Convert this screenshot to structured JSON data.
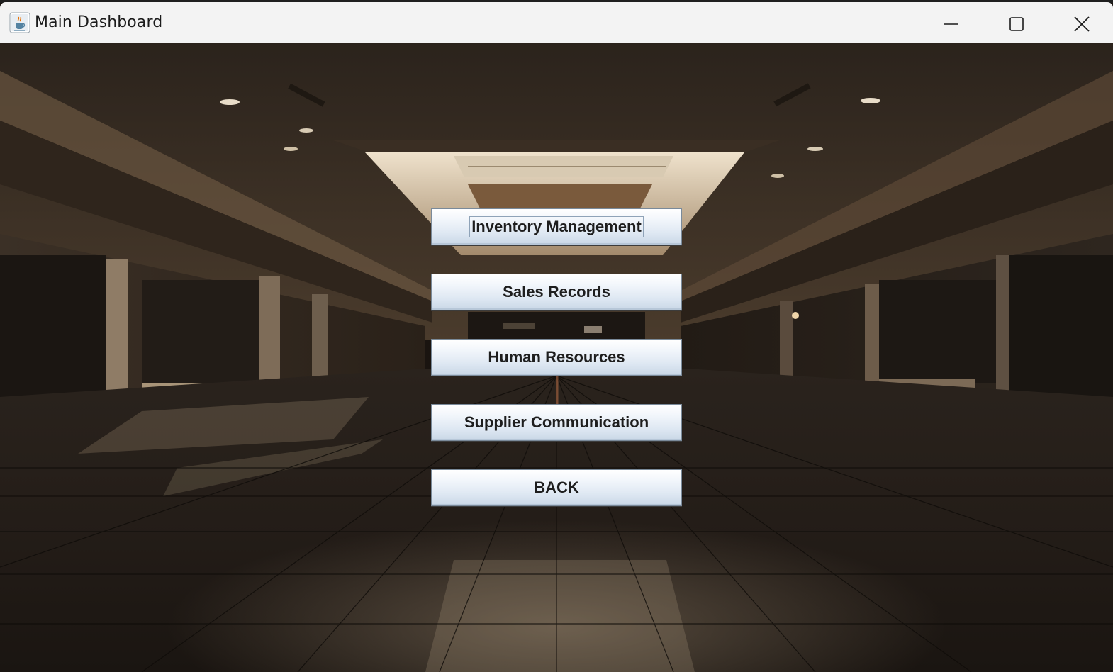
{
  "window": {
    "title": "Main Dashboard",
    "app_icon": "java-coffee-cup-icon",
    "controls": {
      "minimize": "minimize-icon",
      "maximize": "maximize-icon",
      "close": "close-icon"
    }
  },
  "menu": {
    "buttons": [
      {
        "label": "Inventory Management",
        "focused": true
      },
      {
        "label": "Sales Records"
      },
      {
        "label": "Human Resources"
      },
      {
        "label": "Supplier Communication"
      },
      {
        "label": "BACK"
      }
    ]
  },
  "background": {
    "description_icon": "empty-mall-hallway-image"
  },
  "colors": {
    "titlebar": "#f3f3f3",
    "button_top": "#ffffff",
    "button_bottom": "#c9d7e6",
    "button_border": "#7a8a9a"
  }
}
